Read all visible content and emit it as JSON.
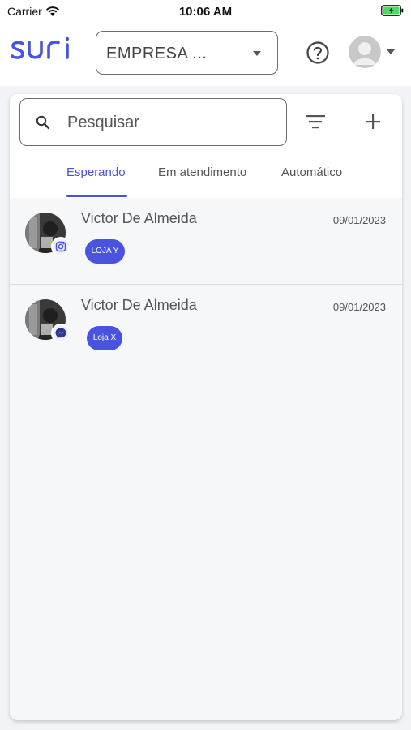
{
  "status_bar": {
    "carrier": "Carrier",
    "time": "10:06 AM"
  },
  "header": {
    "company_select_value": "EMPRESA ...",
    "help_icon": "question-circle-icon",
    "user_avatar_icon": "default-user-avatar-icon"
  },
  "search": {
    "placeholder": "Pesquisar",
    "value": ""
  },
  "tabs": [
    {
      "label": "Esperando",
      "active": true
    },
    {
      "label": "Em atendimento",
      "active": false
    },
    {
      "label": "Automático",
      "active": false
    }
  ],
  "conversations": [
    {
      "name": "Victor De Almeida",
      "date": "09/01/2023",
      "channel": "instagram-icon",
      "store": "LOJA Y"
    },
    {
      "name": "Victor De Almeida",
      "date": "09/01/2023",
      "channel": "messenger-icon",
      "store": "Loja X"
    }
  ],
  "colors": {
    "accent": "#4a52d9",
    "tag_background": "#4a52e0",
    "list_background": "#f6f7f9"
  }
}
